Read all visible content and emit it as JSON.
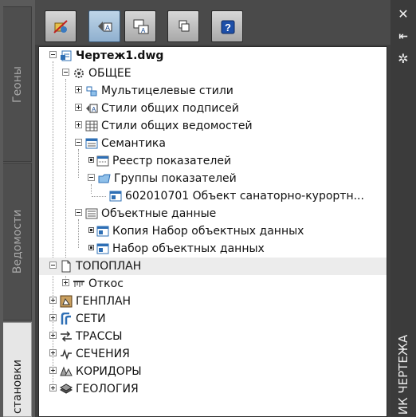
{
  "left_tabs": [
    {
      "label": "Геоны"
    },
    {
      "label": "Ведомости"
    },
    {
      "label": "становки"
    }
  ],
  "right_panel": {
    "title": "ИК ЧЕРТЕЖА",
    "icons": [
      "close-icon",
      "pin-icon",
      "settings-icon"
    ]
  },
  "toolbar": {
    "buttons": [
      "clean-icon",
      "text-style-icon",
      "text-style-replace-icon",
      "copy-icon",
      "help-icon"
    ]
  },
  "tree": {
    "root": "Чертеж1.dwg",
    "general": "ОБЩЕЕ",
    "multileader_styles": "Мультицелевые стили",
    "label_styles": "Стили общих подписей",
    "table_styles": "Стили общих ведомостей",
    "semantics": "Семантика",
    "indicator_registry": "Реестр показателей",
    "indicator_groups": "Группы показателей",
    "group_item": "602010701 Объект санаторно-курортн...",
    "object_data": "Объектные данные",
    "od_copy": "Копия Набор объектных данных",
    "od_set": "Набор объектных данных",
    "topoplan": "ТОПОПЛАН",
    "slope": "Откос",
    "genplan": "ГЕНПЛАН",
    "networks": "СЕТИ",
    "routes": "ТРАССЫ",
    "sections": "СЕЧЕНИЯ",
    "corridors": "КОРИДОРЫ",
    "geology": "ГЕОЛОГИЯ"
  },
  "colors": {
    "accent_blue": "#2e6fb5",
    "panel": "#3f3f3f",
    "tree_bg": "#ffffff"
  }
}
